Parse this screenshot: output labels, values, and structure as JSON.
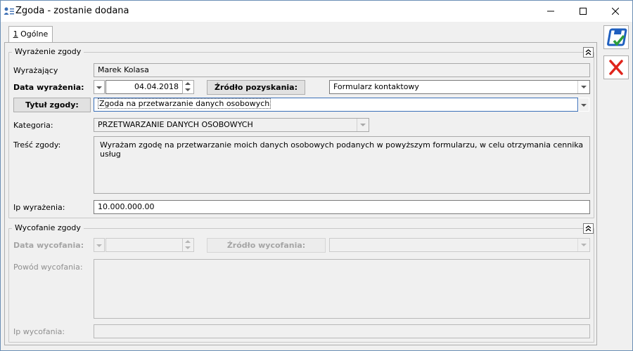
{
  "window": {
    "title": "Zgoda - zostanie dodana"
  },
  "tab": {
    "accel": "1",
    "label": " Ogólne"
  },
  "consent_section": {
    "title": "Wyrażenie zgody",
    "expressing_label": "Wyrażający",
    "expressing_value": "Marek Kolasa",
    "date_label": "Data wyrażenia:",
    "date_value": "04.04.2018",
    "source_button": "Źródło pozyskania:",
    "source_value": "Formularz kontaktowy",
    "title_button": "Tytuł zgody:",
    "title_value": "Zgoda na przetwarzanie danych osobowych",
    "category_label": "Kategoria:",
    "category_value": "PRZETWARZANIE DANYCH OSOBOWYCH",
    "content_label": "Treść zgody:",
    "content_value": "Wyrażam zgodę na przetwarzanie moich danych osobowych podanych w powyższym formularzu, w celu otrzymania cennika usług",
    "ip_label": "Ip wyrażenia:",
    "ip_value": "10.000.000.00"
  },
  "withdraw_section": {
    "title": "Wycofanie zgody",
    "date_label": "Data wycofania:",
    "date_value": "",
    "source_button": "Źródło wycofania:",
    "source_value": "",
    "reason_label": "Powód wycofania:",
    "reason_value": "",
    "ip_label": "Ip wycofania:",
    "ip_value": ""
  },
  "colors": {
    "save_icon": "#1f5fbf",
    "save_check": "#2e9e3a",
    "cancel_icon": "#e0241b"
  },
  "icons": {
    "save": "save-icon",
    "cancel": "cancel-icon",
    "collapse": "collapse-up-icon"
  }
}
